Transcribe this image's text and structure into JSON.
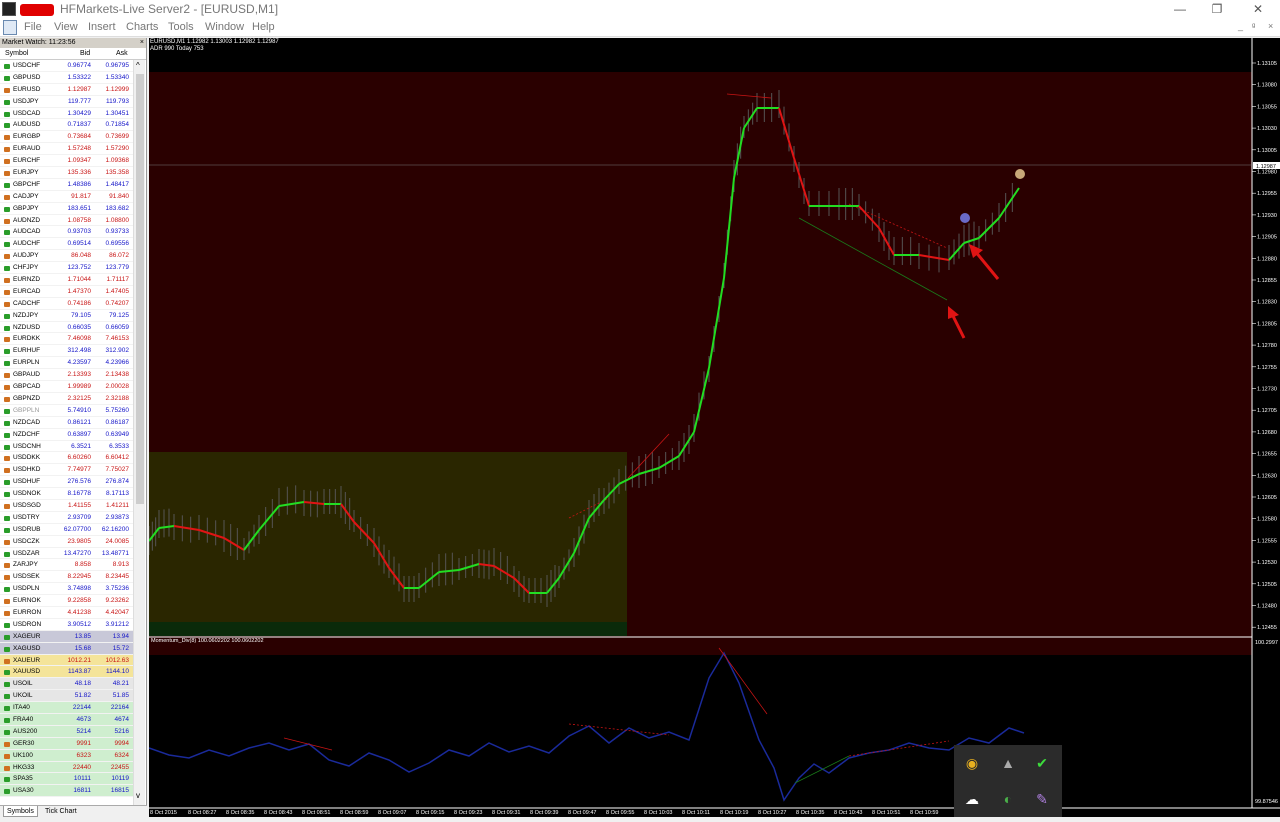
{
  "window": {
    "title": "HFMarkets-Live Server2 - [EURUSD,M1]",
    "min": "—",
    "max": "❐",
    "close": "✕"
  },
  "menu": [
    "File",
    "View",
    "Insert",
    "Charts",
    "Tools",
    "Window",
    "Help"
  ],
  "mdi": {
    "min": "_",
    "restore": "ᵍ",
    "close": "×"
  },
  "market_watch": {
    "title": "Market Watch: 11:23:56",
    "close": "×",
    "headers": {
      "symbol": "Symbol",
      "bid": "Bid",
      "ask": "Ask"
    },
    "rows": [
      {
        "s": "USDCHF",
        "b": "0.96774",
        "a": "0.96795",
        "c": "blue"
      },
      {
        "s": "GBPUSD",
        "b": "1.53322",
        "a": "1.53340",
        "c": "blue"
      },
      {
        "s": "EURUSD",
        "b": "1.12987",
        "a": "1.12999",
        "c": "red"
      },
      {
        "s": "USDJPY",
        "b": "119.777",
        "a": "119.793",
        "c": "blue"
      },
      {
        "s": "USDCAD",
        "b": "1.30429",
        "a": "1.30451",
        "c": "blue"
      },
      {
        "s": "AUDUSD",
        "b": "0.71837",
        "a": "0.71854",
        "c": "blue"
      },
      {
        "s": "EURGBP",
        "b": "0.73684",
        "a": "0.73699",
        "c": "red"
      },
      {
        "s": "EURAUD",
        "b": "1.57248",
        "a": "1.57290",
        "c": "red"
      },
      {
        "s": "EURCHF",
        "b": "1.09347",
        "a": "1.09368",
        "c": "red"
      },
      {
        "s": "EURJPY",
        "b": "135.336",
        "a": "135.358",
        "c": "red"
      },
      {
        "s": "GBPCHF",
        "b": "1.48386",
        "a": "1.48417",
        "c": "blue"
      },
      {
        "s": "CADJPY",
        "b": "91.817",
        "a": "91.840",
        "c": "red"
      },
      {
        "s": "GBPJPY",
        "b": "183.651",
        "a": "183.682",
        "c": "blue"
      },
      {
        "s": "AUDNZD",
        "b": "1.08758",
        "a": "1.08800",
        "c": "red"
      },
      {
        "s": "AUDCAD",
        "b": "0.93703",
        "a": "0.93733",
        "c": "blue"
      },
      {
        "s": "AUDCHF",
        "b": "0.69514",
        "a": "0.69556",
        "c": "blue"
      },
      {
        "s": "AUDJPY",
        "b": "86.048",
        "a": "86.072",
        "c": "red"
      },
      {
        "s": "CHFJPY",
        "b": "123.752",
        "a": "123.779",
        "c": "blue"
      },
      {
        "s": "EURNZD",
        "b": "1.71044",
        "a": "1.71117",
        "c": "red"
      },
      {
        "s": "EURCAD",
        "b": "1.47370",
        "a": "1.47405",
        "c": "red"
      },
      {
        "s": "CADCHF",
        "b": "0.74186",
        "a": "0.74207",
        "c": "red"
      },
      {
        "s": "NZDJPY",
        "b": "79.105",
        "a": "79.125",
        "c": "blue"
      },
      {
        "s": "NZDUSD",
        "b": "0.66035",
        "a": "0.66059",
        "c": "blue"
      },
      {
        "s": "EURDKK",
        "b": "7.46098",
        "a": "7.46153",
        "c": "red"
      },
      {
        "s": "EURHUF",
        "b": "312.498",
        "a": "312.902",
        "c": "blue"
      },
      {
        "s": "EURPLN",
        "b": "4.23597",
        "a": "4.23966",
        "c": "blue"
      },
      {
        "s": "GBPAUD",
        "b": "2.13393",
        "a": "2.13438",
        "c": "red"
      },
      {
        "s": "GBPCAD",
        "b": "1.99989",
        "a": "2.00028",
        "c": "red"
      },
      {
        "s": "GBPNZD",
        "b": "2.32125",
        "a": "2.32188",
        "c": "red"
      },
      {
        "s": "GBPPLN",
        "b": "5.74910",
        "a": "5.75260",
        "c": "blue",
        "grey": true
      },
      {
        "s": "NZDCAD",
        "b": "0.86121",
        "a": "0.86187",
        "c": "blue"
      },
      {
        "s": "NZDCHF",
        "b": "0.63897",
        "a": "0.63949",
        "c": "blue"
      },
      {
        "s": "USDCNH",
        "b": "6.3521",
        "a": "6.3533",
        "c": "blue"
      },
      {
        "s": "USDDKK",
        "b": "6.60260",
        "a": "6.60412",
        "c": "red"
      },
      {
        "s": "USDHKD",
        "b": "7.74977",
        "a": "7.75027",
        "c": "red"
      },
      {
        "s": "USDHUF",
        "b": "276.576",
        "a": "276.874",
        "c": "blue"
      },
      {
        "s": "USDNOK",
        "b": "8.16778",
        "a": "8.17113",
        "c": "blue"
      },
      {
        "s": "USDSGD",
        "b": "1.41155",
        "a": "1.41211",
        "c": "red"
      },
      {
        "s": "USDTRY",
        "b": "2.93709",
        "a": "2.93873",
        "c": "blue"
      },
      {
        "s": "USDRUB",
        "b": "62.07700",
        "a": "62.16200",
        "c": "blue"
      },
      {
        "s": "USDCZK",
        "b": "23.9805",
        "a": "24.0085",
        "c": "red"
      },
      {
        "s": "USDZAR",
        "b": "13.47270",
        "a": "13.48771",
        "c": "blue"
      },
      {
        "s": "ZARJPY",
        "b": "8.858",
        "a": "8.913",
        "c": "red"
      },
      {
        "s": "USDSEK",
        "b": "8.22945",
        "a": "8.23445",
        "c": "red"
      },
      {
        "s": "USDPLN",
        "b": "3.74898",
        "a": "3.75236",
        "c": "blue"
      },
      {
        "s": "EURNOK",
        "b": "9.22858",
        "a": "9.23262",
        "c": "red"
      },
      {
        "s": "EURRON",
        "b": "4.41238",
        "a": "4.42047",
        "c": "red"
      },
      {
        "s": "USDRON",
        "b": "3.90512",
        "a": "3.91212",
        "c": "blue"
      },
      {
        "s": "XAGEUR",
        "b": "13.85",
        "a": "13.94",
        "c": "blue",
        "bg": "#c8c8d8"
      },
      {
        "s": "XAGUSD",
        "b": "15.68",
        "a": "15.72",
        "c": "blue",
        "bg": "#c8c8d8"
      },
      {
        "s": "XAUEUR",
        "b": "1012.21",
        "a": "1012.63",
        "c": "red",
        "bg": "#f4e49a"
      },
      {
        "s": "XAUUSD",
        "b": "1143.87",
        "a": "1144.10",
        "c": "blue",
        "bg": "#f4e49a"
      },
      {
        "s": "USOIL",
        "b": "48.18",
        "a": "48.21",
        "c": "blue",
        "bg": "#e6e6e6"
      },
      {
        "s": "UKOIL",
        "b": "51.82",
        "a": "51.85",
        "c": "blue",
        "bg": "#e6e6e6"
      },
      {
        "s": "ITA40",
        "b": "22144",
        "a": "22164",
        "c": "blue",
        "bg": "#cfeecf"
      },
      {
        "s": "FRA40",
        "b": "4673",
        "a": "4674",
        "c": "blue",
        "bg": "#cfeecf"
      },
      {
        "s": "AUS200",
        "b": "5214",
        "a": "5216",
        "c": "blue",
        "bg": "#cfeecf"
      },
      {
        "s": "GER30",
        "b": "9991",
        "a": "9994",
        "c": "red",
        "bg": "#cfeecf"
      },
      {
        "s": "UK100",
        "b": "6323",
        "a": "6324",
        "c": "red",
        "bg": "#cfeecf"
      },
      {
        "s": "HKG33",
        "b": "22440",
        "a": "22455",
        "c": "red",
        "bg": "#cfeecf"
      },
      {
        "s": "SPA35",
        "b": "10111",
        "a": "10119",
        "c": "blue",
        "bg": "#cfeecf"
      },
      {
        "s": "USA30",
        "b": "16811",
        "a": "16815",
        "c": "blue",
        "bg": "#cfeecf"
      }
    ],
    "tabs": [
      "Symbols",
      "Tick Chart"
    ]
  },
  "chart": {
    "info_line1": "EURUSD,M1  1.12982 1.13003 1.12982 1.12987",
    "info_line2": "ADR 990   Today 753",
    "indicator_label": "Momentum_Div(8) 100.0602202 100.0602202",
    "price_labels": [
      "1.13105",
      "1.13080",
      "1.13055",
      "1.13030",
      "1.13005",
      "1.12980",
      "1.12955",
      "1.12930",
      "1.12905",
      "1.12880",
      "1.12855",
      "1.12830",
      "1.12805",
      "1.12780",
      "1.12755",
      "1.12730",
      "1.12705",
      "1.12680",
      "1.12655",
      "1.12630",
      "1.12605",
      "1.12580",
      "1.12555",
      "1.12530",
      "1.12505",
      "1.12480",
      "1.12455"
    ],
    "current_price": "1.12987",
    "indicator_max": "100.2997",
    "indicator_min": "99.87546",
    "time_labels": [
      "8 Oct 2015",
      "8 Oct 08:27",
      "8 Oct 08:35",
      "8 Oct 08:43",
      "8 Oct 08:51",
      "8 Oct 08:59",
      "8 Oct 09:07",
      "8 Oct 09:15",
      "8 Oct 09:23",
      "8 Oct 09:31",
      "8 Oct 09:39",
      "8 Oct 09:47",
      "8 Oct 09:55",
      "8 Oct 10:03",
      "8 Oct 10:11",
      "8 Oct 10:19",
      "8 Oct 10:27",
      "8 Oct 10:35",
      "8 Oct 10:43",
      "8 Oct 10:51",
      "8 Oct 10:59"
    ],
    "colors": {
      "up": "#22dd22",
      "down": "#e01414",
      "zone_red": "#2a0000",
      "zone_olive": "#2a2600",
      "indicator": "#1a2a9a"
    }
  },
  "tray": {
    "icons": [
      "chrome-icon",
      "notification-icon",
      "check-icon",
      "cloud-icon",
      "network-icon",
      "feather-icon"
    ]
  }
}
